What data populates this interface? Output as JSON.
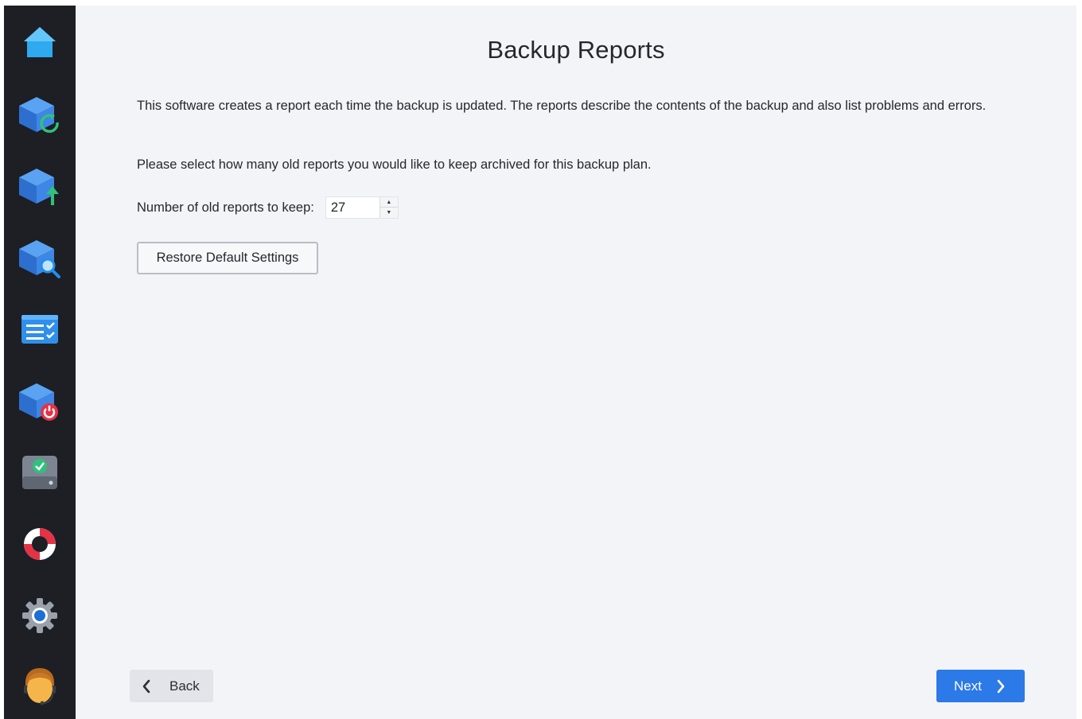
{
  "sidebar": {
    "items": [
      {
        "icon": "home-icon"
      },
      {
        "icon": "backup-refresh-icon"
      },
      {
        "icon": "backup-upload-icon"
      },
      {
        "icon": "backup-search-icon"
      },
      {
        "icon": "checklist-icon"
      },
      {
        "icon": "backup-power-icon"
      },
      {
        "icon": "drive-check-icon"
      },
      {
        "icon": "lifebuoy-icon"
      },
      {
        "icon": "gear-icon"
      },
      {
        "icon": "user-avatar-icon"
      }
    ]
  },
  "main": {
    "title": "Backup Reports",
    "description": "This software creates a report each time the backup is updated. The reports describe the contents of the backup and also list problems and errors.",
    "instruction": "Please select how many old reports you would like to keep archived for this backup plan.",
    "keep_label": "Number of old reports to keep:",
    "keep_value": "27",
    "restore_button": "Restore Default Settings"
  },
  "footer": {
    "back_label": "Back",
    "next_label": "Next"
  },
  "colors": {
    "sidebar_bg": "#1d1f24",
    "content_bg": "#f3f4f8",
    "accent": "#2c79e8"
  }
}
